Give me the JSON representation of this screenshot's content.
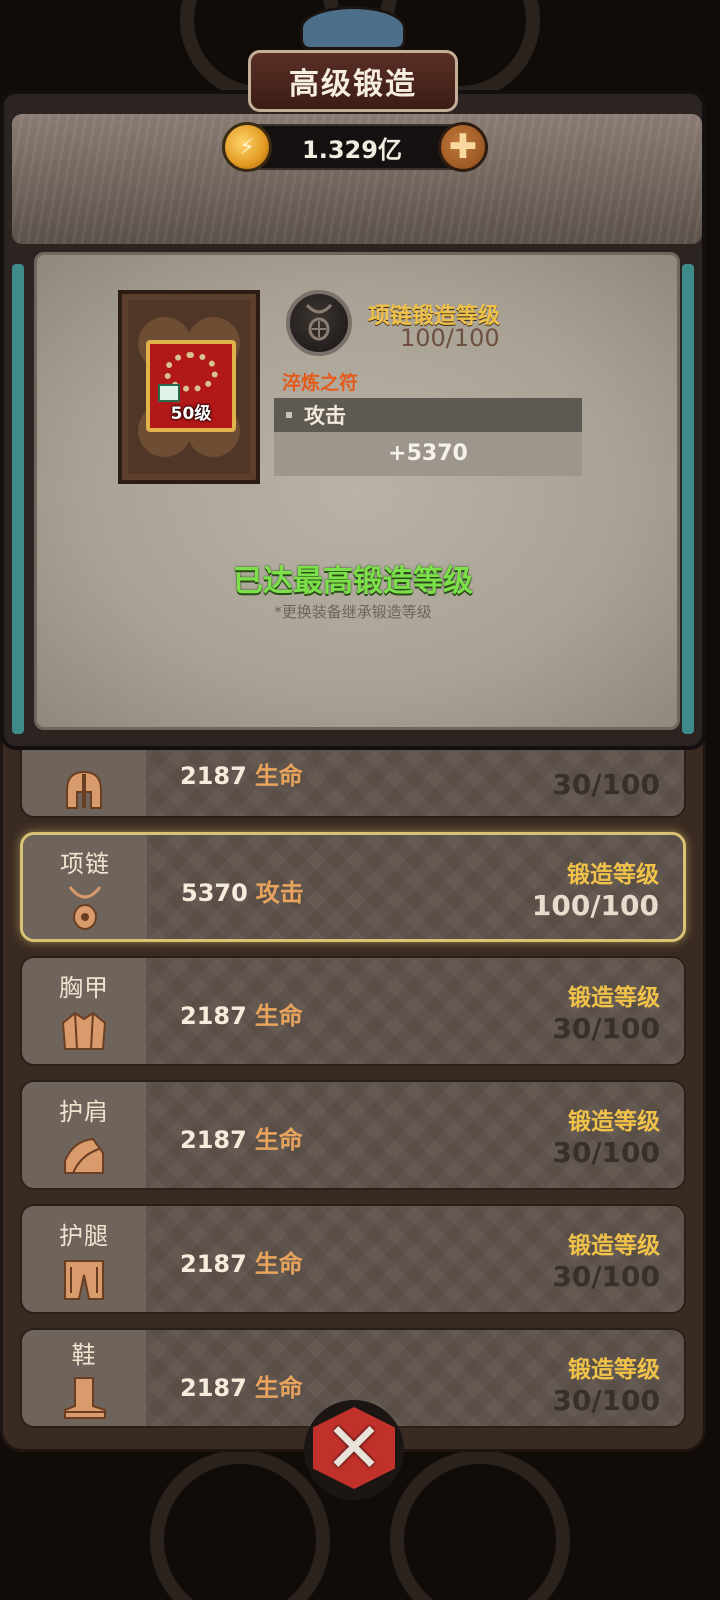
{
  "header": {
    "title": "高级锻造",
    "currency_value": "1.329亿",
    "plus_symbol": "✚"
  },
  "detail": {
    "item_level": "50级",
    "forge_title": "项链锻造等级",
    "forge_progress": "100/100",
    "rune_name": "淬炼之符",
    "attr_name": "攻击",
    "attr_value": "+5370",
    "max_message": "已达最高锻造等级",
    "note": "*更换装备继承锻造等级"
  },
  "rows": [
    {
      "slot": "",
      "icon": "helmet-icon",
      "value": "2187",
      "kind": "生命",
      "level_label": "",
      "level": "30/100",
      "selected": false
    },
    {
      "slot": "项链",
      "icon": "necklace-icon",
      "value": "5370",
      "kind": "攻击",
      "level_label": "锻造等级",
      "level": "100/100",
      "selected": true
    },
    {
      "slot": "胸甲",
      "icon": "chestplate-icon",
      "value": "2187",
      "kind": "生命",
      "level_label": "锻造等级",
      "level": "30/100",
      "selected": false
    },
    {
      "slot": "护肩",
      "icon": "shoulder-icon",
      "value": "2187",
      "kind": "生命",
      "level_label": "锻造等级",
      "level": "30/100",
      "selected": false
    },
    {
      "slot": "护腿",
      "icon": "leggings-icon",
      "value": "2187",
      "kind": "生命",
      "level_label": "锻造等级",
      "level": "30/100",
      "selected": false
    },
    {
      "slot": "鞋",
      "icon": "boots-icon",
      "value": "2187",
      "kind": "生命",
      "level_label": "锻造等级",
      "level": "30/100",
      "selected": false
    }
  ],
  "close_symbol": "✕",
  "colors": {
    "accent_gold": "#f0c24a",
    "max_green": "#7ce04a",
    "rune_orange": "#e35a1a",
    "close_red": "#c0312a"
  }
}
